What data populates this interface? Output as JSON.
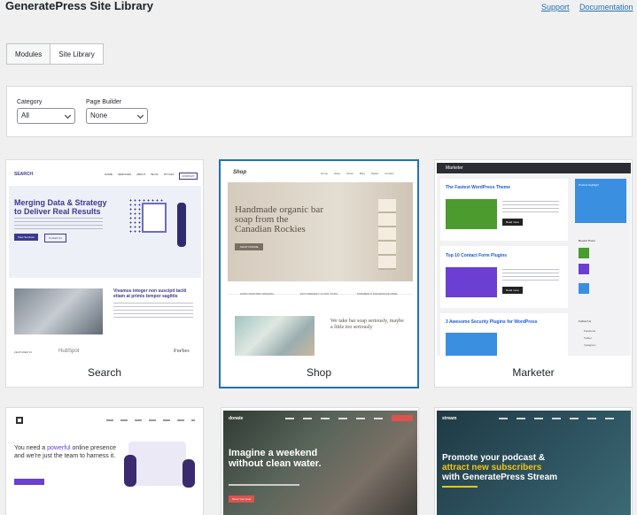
{
  "header": {
    "title": "GeneratePress Site Library",
    "links": {
      "support": "Support",
      "documentation": "Documentation"
    }
  },
  "tabs": [
    {
      "label": "Modules",
      "active": false
    },
    {
      "label": "Site Library",
      "active": true
    }
  ],
  "filters": {
    "category": {
      "label": "Category",
      "value": "All"
    },
    "page_builder": {
      "label": "Page Builder",
      "value": "None"
    }
  },
  "sites": [
    {
      "name": "Search",
      "preview": {
        "logo": "SEARCH",
        "nav": [
          "HOME",
          "SERVICES",
          "ABOUT",
          "BLOG",
          "STYLES",
          "CONTACT"
        ],
        "headline": "Merging Data & Strategy to Deliver Real Results",
        "buttons": [
          "View Services",
          "Contact Us"
        ],
        "section_title": "Vivamus integer non suscipit taciti etiam at primis tempor sagittis",
        "featured_label": "FEATURED IN",
        "logos": [
          "HubSpot",
          "Forbes"
        ]
      }
    },
    {
      "name": "Shop",
      "preview": {
        "logo": "Shop",
        "nav": [
          "Home",
          "Shop",
          "About",
          "Blog",
          "Styles",
          "Contact"
        ],
        "headline": "Handmade organic bar soap from the Canadian Rockies",
        "cta": "SHOP ONLINE",
        "features": [
          "HAND CRAFTED ORGANIC",
          "ECO FRIENDLY & NON-TOXIC",
          "PARABEN & FRAGRANCE FREE"
        ],
        "tagline": "We take bar soap seriously, maybe a little too seriously"
      }
    },
    {
      "name": "Marketer",
      "preview": {
        "logo": "Marketer",
        "posts": [
          "The Fastest WordPress Theme",
          "Top 10 Contact Form Plugins",
          "3 Awesome Security Plugins for WordPress"
        ],
        "read_more": "Read more",
        "sidebar_titles": [
          "Product Highlight",
          "Recent Posts",
          "Follow Us"
        ],
        "social": [
          "Facebook",
          "Twitter",
          "Instagram"
        ]
      }
    },
    {
      "name": "",
      "preview": {
        "headline_start": "You need a ",
        "headline_highlight": "powerful",
        "headline_end": " online presence and we're just the team to harness it."
      }
    },
    {
      "name": "",
      "preview": {
        "logo": "donate",
        "headline": "Imagine a weekend without clean water.",
        "cta": "Show Your Help"
      }
    },
    {
      "name": "",
      "preview": {
        "logo": "stream",
        "headline_start": "Promote your podcast &",
        "headline_highlight": "attract new subscribers",
        "headline_end": "with GeneratePress Stream"
      }
    }
  ],
  "colors": {
    "link": "#2271b1",
    "selected_border": "#2271b1",
    "search_accent": "#3b3a8f",
    "marketer_green": "#4b9b2f",
    "marketer_purple": "#6a3fd1",
    "marketer_blue": "#3a8fe0",
    "stream_accent": "#f0c419"
  }
}
